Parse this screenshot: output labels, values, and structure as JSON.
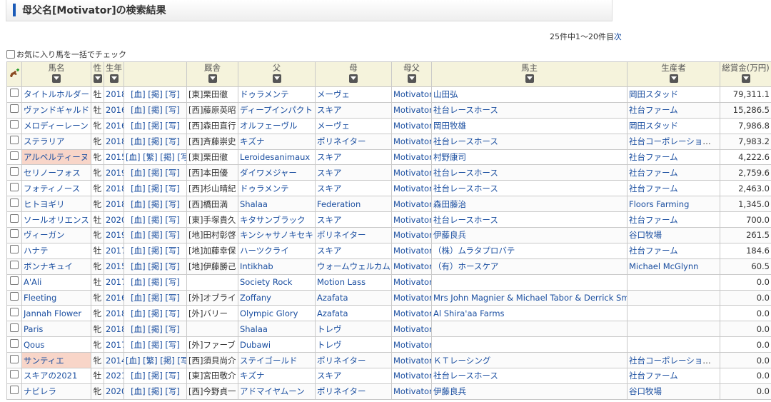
{
  "header": {
    "title": "母父名[Motivator]の検索結果"
  },
  "pager": {
    "summary": "25件中1～20件目",
    "separator": "|",
    "next": "次"
  },
  "check_all": {
    "label": "お気に入り馬を一括でチェック"
  },
  "columns": {
    "name": "馬名",
    "sex": "性",
    "year": "生年",
    "links": "",
    "stable": "厩舎",
    "sire": "父",
    "dam": "母",
    "damsire": "母父",
    "owner": "馬主",
    "breeder": "生産者",
    "money": "総賞金(万円)"
  },
  "rows": [
    {
      "name": "タイトルホルダー",
      "sex": "牡",
      "year": "2018",
      "links": "[血] [掲] [写]",
      "stable": "[東]栗田徹",
      "sire": "ドゥラメンテ",
      "dam": "メーヴェ",
      "damsire": "Motivator",
      "owner": "山田弘",
      "breeder": "岡田スタッド",
      "money": "79,311.1",
      "hl": false
    },
    {
      "name": "ヴァンドギャルド",
      "sex": "牡",
      "year": "2016",
      "links": "[血] [掲] [写]",
      "stable": "[西]藤原英昭",
      "sire": "ディープインパクト",
      "dam": "スキア",
      "damsire": "Motivator",
      "owner": "社台レースホース",
      "breeder": "社台ファーム",
      "money": "15,286.5",
      "hl": false
    },
    {
      "name": "メロディーレーン",
      "sex": "牝",
      "year": "2016",
      "links": "[血] [掲] [写]",
      "stable": "[西]森田直行",
      "sire": "オルフェーヴル",
      "dam": "メーヴェ",
      "damsire": "Motivator",
      "owner": "岡田牧雄",
      "breeder": "岡田スタッド",
      "money": "7,986.8",
      "hl": false
    },
    {
      "name": "ステラリア",
      "sex": "牝",
      "year": "2018",
      "links": "[血] [掲] [写]",
      "stable": "[西]斉藤崇史",
      "sire": "キズナ",
      "dam": "ポリネイター",
      "damsire": "Motivator",
      "owner": "社台レースホース",
      "breeder": "社台コーポレーション...",
      "money": "7,983.2",
      "hl": false
    },
    {
      "name": "アルベルティーヌ",
      "sex": "牝",
      "year": "2015",
      "links": "[血] [繁] [掲] [写]",
      "stable": "[東]栗田徹",
      "sire": "Leroidesanimaux",
      "dam": "スキア",
      "damsire": "Motivator",
      "owner": "村野康司",
      "breeder": "社台ファーム",
      "money": "4,222.6",
      "hl": true
    },
    {
      "name": "セリノーフォス",
      "sex": "牝",
      "year": "2019",
      "links": "[血] [掲] [写]",
      "stable": "[西]本田優",
      "sire": "ダイワメジャー",
      "dam": "スキア",
      "damsire": "Motivator",
      "owner": "社台レースホース",
      "breeder": "社台ファーム",
      "money": "2,759.6",
      "hl": false
    },
    {
      "name": "フォティノース",
      "sex": "牝",
      "year": "2018",
      "links": "[血] [掲] [写]",
      "stable": "[西]杉山晴紀",
      "sire": "ドゥラメンテ",
      "dam": "スキア",
      "damsire": "Motivator",
      "owner": "社台レースホース",
      "breeder": "社台ファーム",
      "money": "2,463.0",
      "hl": false
    },
    {
      "name": "ヒトヨギリ",
      "sex": "牝",
      "year": "2018",
      "links": "[血] [掲] [写]",
      "stable": "[西]橋田満",
      "sire": "Shalaa",
      "dam": "Federation",
      "damsire": "Motivator",
      "owner": "森田藤治",
      "breeder": "Floors Farming",
      "money": "1,345.0",
      "hl": false
    },
    {
      "name": "ソールオリエンス",
      "sex": "牡",
      "year": "2020",
      "links": "[血] [掲] [写]",
      "stable": "[東]手塚貴久",
      "sire": "キタサンブラック",
      "dam": "スキア",
      "damsire": "Motivator",
      "owner": "社台レースホース",
      "breeder": "社台ファーム",
      "money": "700.0",
      "hl": false
    },
    {
      "name": "ヴィーガン",
      "sex": "牝",
      "year": "2019",
      "links": "[血] [掲] [写]",
      "stable": "[地]田村彰啓",
      "sire": "キンシャサノキセキ",
      "dam": "ポリネイター",
      "damsire": "Motivator",
      "owner": "伊藤良兵",
      "breeder": "谷口牧場",
      "money": "261.5",
      "hl": false
    },
    {
      "name": "ハナテ",
      "sex": "牡",
      "year": "2017",
      "links": "[血] [掲] [写]",
      "stable": "[地]加藤幸保",
      "sire": "ハーツクライ",
      "dam": "スキア",
      "damsire": "Motivator",
      "owner": "（株）ムラタプロバテ",
      "breeder": "社台ファーム",
      "money": "184.6",
      "hl": false
    },
    {
      "name": "ボンナキュイ",
      "sex": "牝",
      "year": "2015",
      "links": "[血] [掲] [写]",
      "stable": "[地]伊藤勝己",
      "sire": "Intikhab",
      "dam": "ウォームウェルカム",
      "damsire": "Motivator",
      "owner": "（有）ホースケア",
      "breeder": "Michael McGlynn",
      "money": "60.5",
      "hl": false
    },
    {
      "name": "A'Ali",
      "sex": "牡",
      "year": "2017",
      "links": "[血] [掲] [写]",
      "stable": "",
      "sire": "Society Rock",
      "dam": "Motion Lass",
      "damsire": "Motivator",
      "owner": "",
      "breeder": "",
      "money": "0.0",
      "hl": false
    },
    {
      "name": "Fleeting",
      "sex": "牝",
      "year": "2016",
      "links": "[血] [掲] [写]",
      "stable": "[外]オブライ",
      "sire": "Zoffany",
      "dam": "Azafata",
      "damsire": "Motivator",
      "owner": "Mrs John Magnier & Michael Tabor & Derrick Smith",
      "breeder": "",
      "money": "0.0",
      "hl": false
    },
    {
      "name": "Jannah Flower",
      "sex": "牝",
      "year": "2018",
      "links": "[血] [掲] [写]",
      "stable": "[外]バリー",
      "sire": "Olympic Glory",
      "dam": "Azafata",
      "damsire": "Motivator",
      "owner": "Al Shira'aa Farms",
      "breeder": "",
      "money": "0.0",
      "hl": false
    },
    {
      "name": "Paris",
      "sex": "牝",
      "year": "2018",
      "links": "[血] [掲] [写]",
      "stable": "",
      "sire": "Shalaa",
      "dam": "トレヴ",
      "damsire": "Motivator",
      "owner": "",
      "breeder": "",
      "money": "0.0",
      "hl": false
    },
    {
      "name": "Qous",
      "sex": "牝",
      "year": "2017",
      "links": "[血] [掲] [写]",
      "stable": "[外]ファーブ",
      "sire": "Dubawi",
      "dam": "トレヴ",
      "damsire": "Motivator",
      "owner": "",
      "breeder": "",
      "money": "0.0",
      "hl": false
    },
    {
      "name": "サンティエ",
      "sex": "牝",
      "year": "2014",
      "links": "[血] [繁] [掲] [写]",
      "stable": "[西]須貝尚介",
      "sire": "ステイゴールド",
      "dam": "ポリネイター",
      "damsire": "Motivator",
      "owner": "ＫＴレーシング",
      "breeder": "社台コーポレーション...",
      "money": "0.0",
      "hl": true
    },
    {
      "name": "スキアの2021",
      "sex": "牡",
      "year": "2021",
      "links": "[血] [掲] [写]",
      "stable": "[東]宮田敬介",
      "sire": "キズナ",
      "dam": "スキア",
      "damsire": "Motivator",
      "owner": "社台レースホース",
      "breeder": "社台ファーム",
      "money": "0.0",
      "hl": false
    },
    {
      "name": "ナビレラ",
      "sex": "牝",
      "year": "2020",
      "links": "[血] [掲] [写]",
      "stable": "[西]今野貞一",
      "sire": "アドマイヤムーン",
      "dam": "ポリネイター",
      "damsire": "Motivator",
      "owner": "伊藤良兵",
      "breeder": "谷口牧場",
      "money": "0.0",
      "hl": false
    }
  ]
}
